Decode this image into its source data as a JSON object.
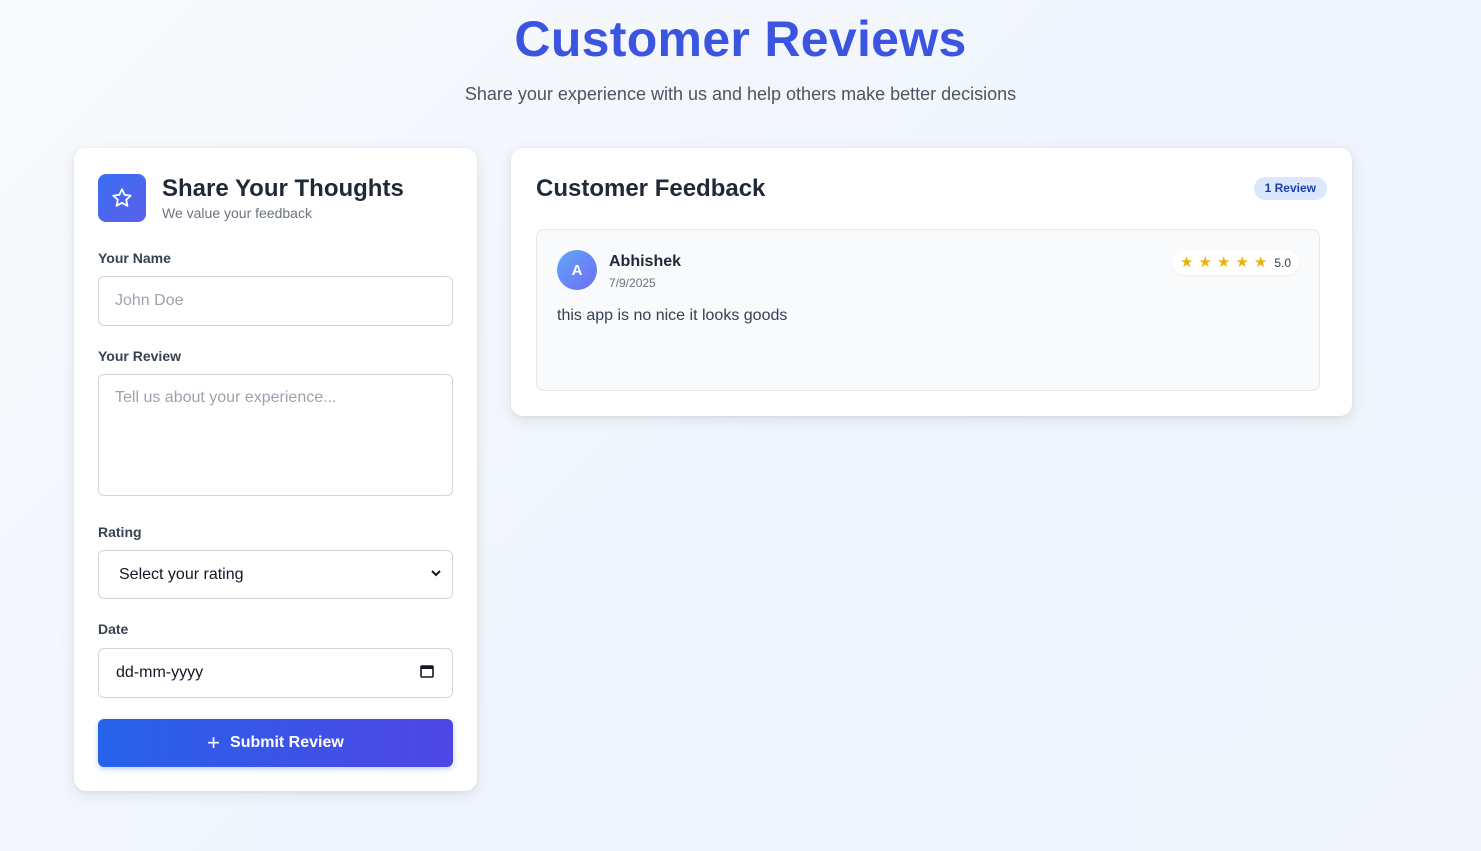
{
  "header": {
    "title": "Customer Reviews",
    "subtitle": "Share your experience with us and help others make better decisions"
  },
  "form": {
    "title": "Share Your Thoughts",
    "subtitle": "We value your feedback",
    "name_label": "Your Name",
    "name_placeholder": "John Doe",
    "name_value": "",
    "review_label": "Your Review",
    "review_placeholder": "Tell us about your experience...",
    "review_value": "",
    "rating_label": "Rating",
    "rating_selected": "Select your rating",
    "date_label": "Date",
    "date_placeholder": "dd-mm-yyyy",
    "submit_label": "Submit Review",
    "submit_icon": "plus-icon"
  },
  "feedback": {
    "title": "Customer Feedback",
    "count_label": "1 Review",
    "reviews": [
      {
        "avatar_initial": "A",
        "name": "Abhishek",
        "date": "7/9/2025",
        "stars": 5,
        "rating_text": "5.0",
        "text": "this app is no nice it looks goods"
      }
    ]
  },
  "colors": {
    "accent": "#3b55e0",
    "button_start": "#2663eb",
    "button_end": "#4f46e5",
    "star": "#eab308",
    "badge_bg": "#dbe7fe"
  }
}
